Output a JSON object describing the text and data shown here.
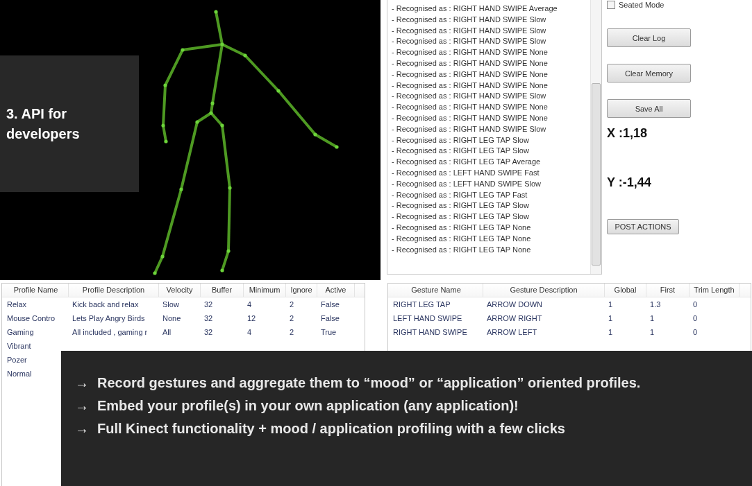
{
  "caption": "3. API for developers",
  "log": [
    "- Recognised as : RIGHT HAND SWIPE Average",
    "- Recognised as : RIGHT HAND SWIPE Slow",
    "- Recognised as : RIGHT HAND SWIPE Slow",
    "- Recognised as : RIGHT HAND SWIPE Slow",
    "- Recognised as : RIGHT HAND SWIPE None",
    "- Recognised as : RIGHT HAND SWIPE None",
    "- Recognised as : RIGHT HAND SWIPE None",
    "- Recognised as : RIGHT HAND SWIPE None",
    "- Recognised as : RIGHT HAND SWIPE Slow",
    "- Recognised as : RIGHT HAND SWIPE None",
    "- Recognised as : RIGHT HAND SWIPE None",
    "- Recognised as : RIGHT HAND SWIPE Slow",
    "- Recognised as : RIGHT LEG TAP Slow",
    "- Recognised as : RIGHT LEG TAP Slow",
    "- Recognised as : RIGHT LEG TAP Average",
    "- Recognised as : LEFT HAND SWIPE Fast",
    "- Recognised as : LEFT HAND SWIPE Slow",
    "- Recognised as : RIGHT LEG TAP Fast",
    "- Recognised as : RIGHT LEG TAP Slow",
    "- Recognised as : RIGHT LEG TAP Slow",
    "- Recognised as : RIGHT LEG TAP None",
    "- Recognised as : RIGHT LEG TAP None",
    "- Recognised as : RIGHT LEG TAP None"
  ],
  "seated_mode": {
    "label": "Seated Mode",
    "checked": false
  },
  "buttons": [
    "Clear Log",
    "Clear Memory",
    "Save All"
  ],
  "x_reading": "X :1,18",
  "y_reading": "Y :-1,44",
  "post_button": "POST ACTIONS",
  "profiles_table": {
    "columns": [
      "Profile Name",
      "Profile Description",
      "Velocity",
      "Buffer",
      "Minimum",
      "Ignore",
      "Active"
    ],
    "rows": [
      [
        "Relax",
        "Kick back and relax",
        "Slow",
        "32",
        "4",
        "2",
        "False"
      ],
      [
        "Mouse Contro",
        "Lets Play Angry Birds",
        "None",
        "32",
        "12",
        "2",
        "False"
      ],
      [
        "Gaming",
        "All included , gaming r",
        "All",
        "32",
        "4",
        "2",
        "True"
      ],
      [
        "Vibrant"
      ],
      [
        "Pozer"
      ],
      [
        "Normal"
      ]
    ]
  },
  "gestures_table": {
    "columns": [
      "Gesture Name",
      "Gesture Description",
      "Global",
      "First",
      "Trim Length"
    ],
    "rows": [
      [
        "RIGHT LEG TAP",
        "ARROW DOWN",
        "1",
        "1.3",
        "0"
      ],
      [
        "LEFT HAND SWIPE",
        "ARROW RIGHT",
        "1",
        "1",
        "0"
      ],
      [
        "RIGHT HAND SWIPE",
        "ARROW LEFT",
        "1",
        "1",
        "0"
      ]
    ]
  },
  "bullets": [
    {
      "arrow": "→",
      "text": "Record gestures and aggregate them to “mood” or “application” oriented profiles."
    },
    {
      "arrow": "→",
      "text": "Embed your profile(s) in your own application (any application)!"
    },
    {
      "arrow": "→",
      "text": "Full Kinect functionality + mood / application profiling with a few clicks"
    }
  ]
}
